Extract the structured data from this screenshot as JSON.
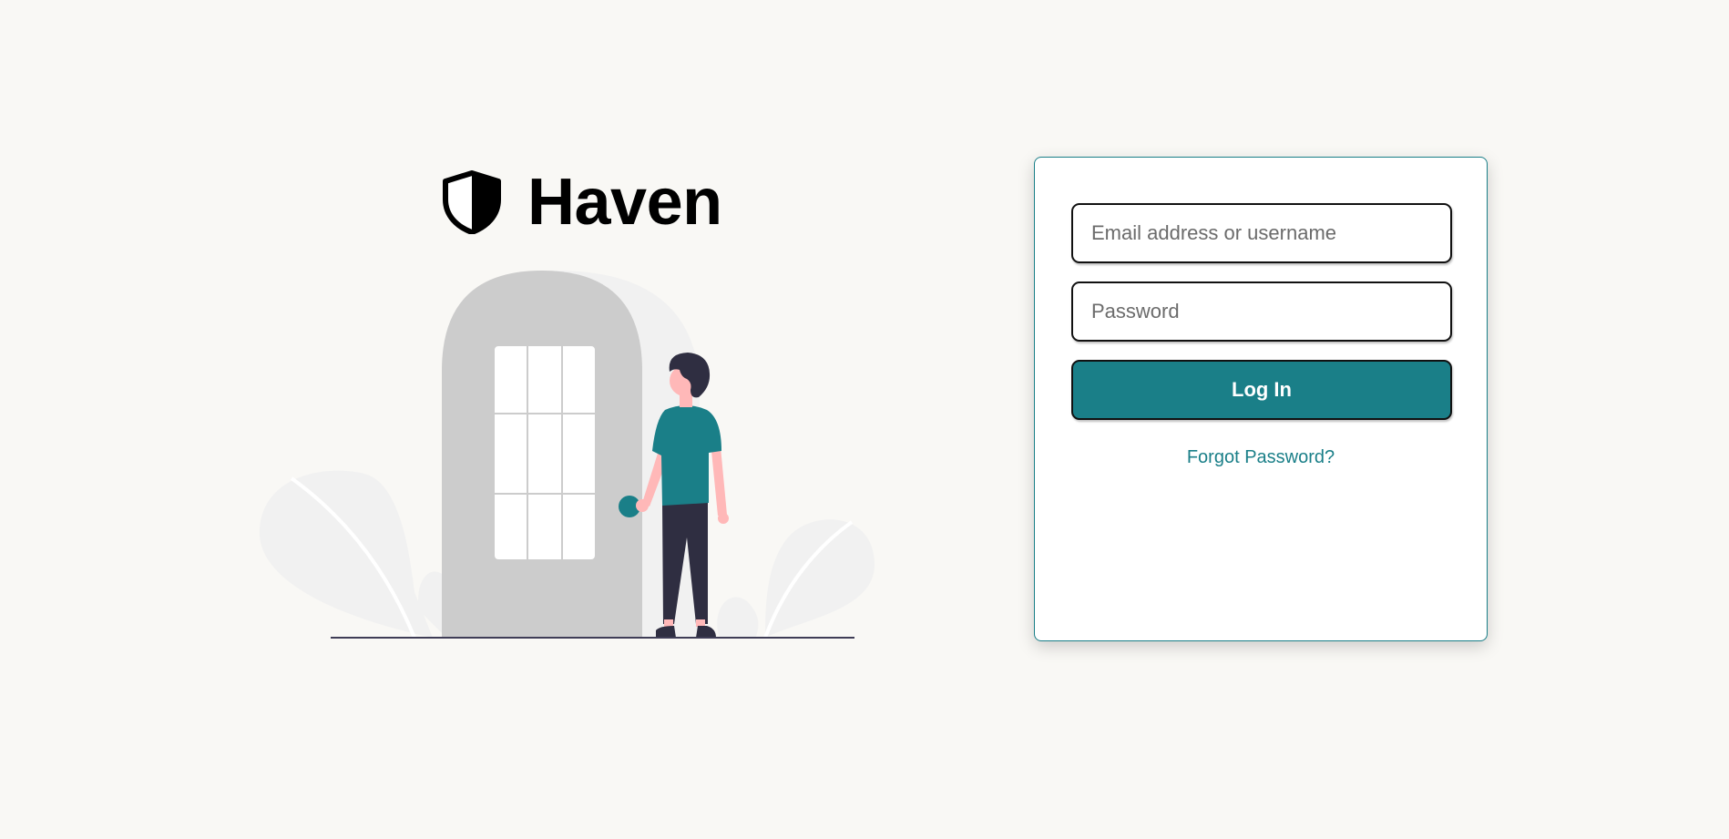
{
  "brand": {
    "name": "Haven",
    "logo_icon": "shield-icon"
  },
  "illustration": {
    "subject": "person-at-door-illustration",
    "colors": {
      "accent": "#1a7f88",
      "door": "#cccccc",
      "foliage": "#f1f1f1",
      "window": "#ffffff",
      "pants": "#2f2e41",
      "skin": "#ffb8b8",
      "ground": "#3f3d56"
    }
  },
  "login": {
    "email_placeholder": "Email address or username",
    "password_placeholder": "Password",
    "submit_label": "Log In",
    "forgot_label": "Forgot Password?"
  },
  "theme": {
    "background": "#f9f8f5",
    "accent": "#1a7f88",
    "card_background": "#ffffff"
  }
}
